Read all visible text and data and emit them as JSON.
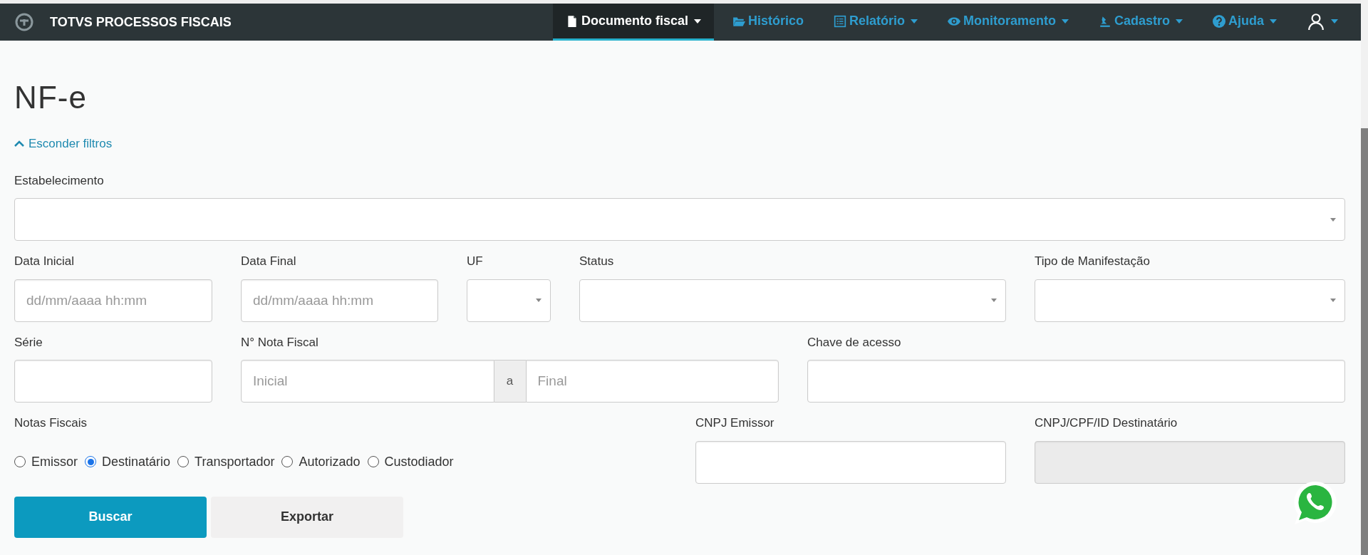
{
  "app": {
    "title": "TOTVS PROCESSOS FISCAIS"
  },
  "nav": [
    {
      "label": "Documento fiscal",
      "dropdown": true,
      "selected": true
    },
    {
      "label": "Histórico",
      "dropdown": false,
      "selected": false
    },
    {
      "label": "Relatório",
      "dropdown": true,
      "selected": false
    },
    {
      "label": "Monitoramento",
      "dropdown": true,
      "selected": false
    },
    {
      "label": "Cadastro",
      "dropdown": true,
      "selected": false
    },
    {
      "label": "Ajuda",
      "dropdown": true,
      "selected": false
    },
    {
      "dropdown": true,
      "selected": false
    }
  ],
  "page": {
    "title": "NF-e",
    "filters_toggle": "Esconder filtros",
    "filters_expanded": true
  },
  "estabelecimento": {
    "label": "Estabelecimento"
  },
  "row2": [
    {
      "kind": "text",
      "label": "Data Inicial",
      "placeholder": "dd/mm/aaaa hh:mm"
    },
    {
      "kind": "text",
      "label": "Data Final",
      "placeholder": "dd/mm/aaaa hh:mm"
    },
    {
      "kind": "select",
      "label": "UF"
    },
    {
      "kind": "select",
      "label": "Status"
    },
    {
      "kind": "select",
      "label": "Tipo de Manifestação"
    }
  ],
  "serie": {
    "label": "Série"
  },
  "nota_fiscal": {
    "label": "N° Nota Fiscal",
    "from_placeholder": "Inicial",
    "separator": "a",
    "to_placeholder": "Final"
  },
  "chave": {
    "label": "Chave de acesso"
  },
  "notas_fiscais": {
    "label": "Notas Fiscais",
    "options": [
      {
        "label": "Emissor",
        "selected": false
      },
      {
        "label": "Destinatário",
        "selected": true
      },
      {
        "label": "Transportador",
        "selected": false
      },
      {
        "label": "Autorizado",
        "selected": false
      },
      {
        "label": "Custodiador",
        "selected": false
      }
    ]
  },
  "cnpj_emissor": {
    "label": "CNPJ Emissor",
    "disabled": false
  },
  "cnpj_destinatario": {
    "label": "CNPJ/CPF/ID Destinatário",
    "disabled": true
  },
  "buttons": [
    {
      "label": "Buscar",
      "kind": "primary"
    },
    {
      "label": "Exportar",
      "kind": "secondary"
    }
  ]
}
